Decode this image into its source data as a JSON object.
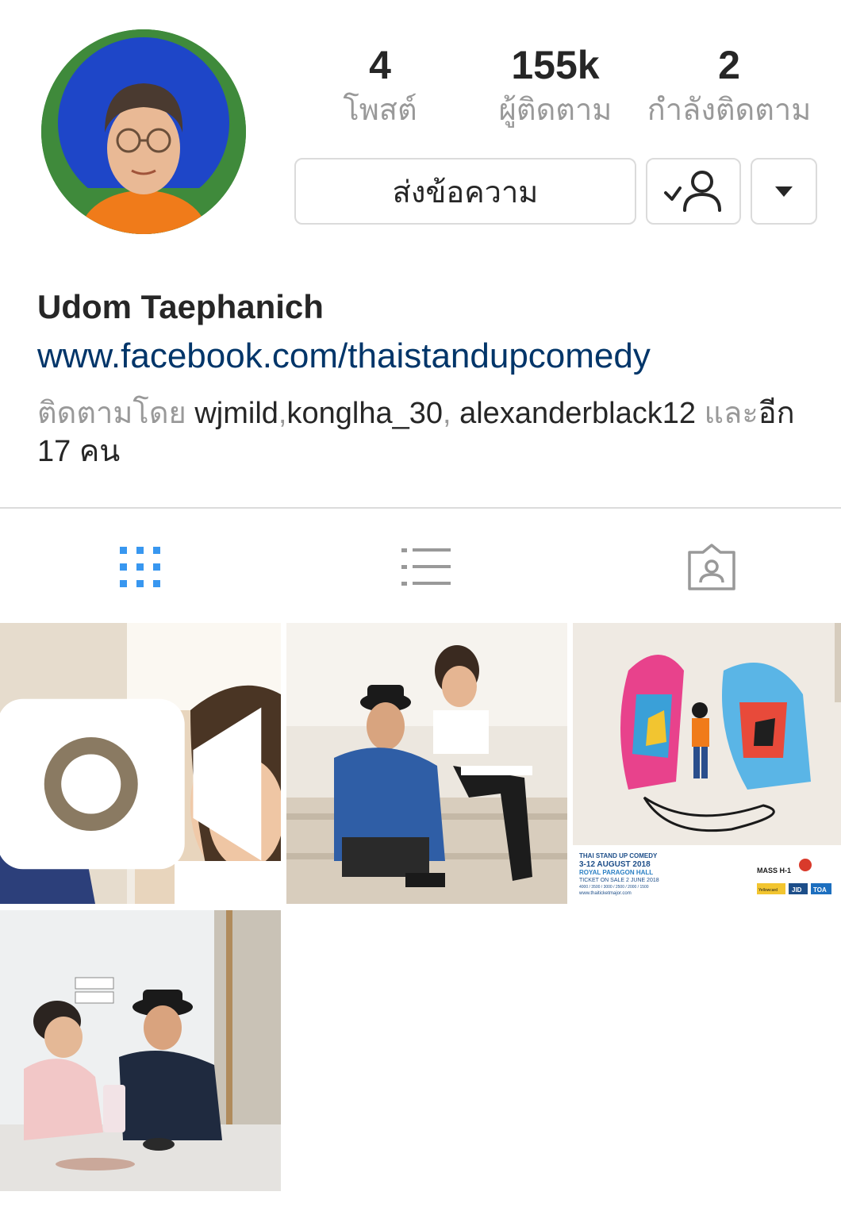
{
  "profile": {
    "name": "Udom Taephanich",
    "link": "www.facebook.com/thaistandupcomedy",
    "avatar": "profile-photo"
  },
  "stats": [
    {
      "value": "4",
      "label": "โพสต์"
    },
    {
      "value": "155k",
      "label": "ผู้ติดตาม"
    },
    {
      "value": "2",
      "label": "กำลังติดตาม"
    }
  ],
  "actions": {
    "message_label": "ส่งข้อความ",
    "following_icon": "user-check-icon",
    "more_icon": "caret-down-icon"
  },
  "followed_by": {
    "prefix": "ติดตามโดย ",
    "users": [
      "wjmild",
      "konglha_30",
      "alexanderblack12"
    ],
    "separator_1": ",",
    "separator_2": ", ",
    "and": " และ",
    "more": "อีก 17 คน"
  },
  "tabs": [
    {
      "name": "grid",
      "icon": "grid-icon",
      "active": true
    },
    {
      "name": "list",
      "icon": "list-icon",
      "active": false
    },
    {
      "name": "tagged",
      "icon": "tagged-icon",
      "active": false
    }
  ],
  "posts": [
    {
      "type": "video",
      "badge_icon": "video-camera-icon"
    },
    {
      "type": "photo"
    },
    {
      "type": "photo",
      "poster": {
        "line1": "THAI STAND UP COMEDY",
        "line2": "3-12 AUGUST 2018",
        "line3": "ROYAL PARAGON HALL",
        "line4": "TICKET ON SALE 2 JUNE 2018",
        "line5": "4000 / 3500 / 3000 / 2500 / 2000 / 1500",
        "line6": "www.thaiticketmajor.com",
        "sponsor1": "MASS H-1",
        "sponsor2": "Yellowcard",
        "sponsor3": "JID",
        "sponsor4": "TOA"
      }
    },
    {
      "type": "photo"
    }
  ],
  "colors": {
    "accent_blue": "#3897f0",
    "link_blue": "#003569",
    "muted": "#999999",
    "border": "#dbdbdb"
  }
}
